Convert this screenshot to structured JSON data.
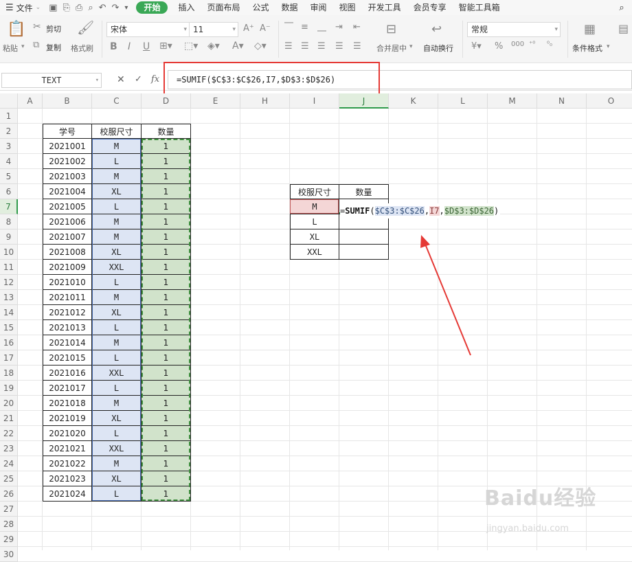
{
  "menu": {
    "file_label": "文件",
    "tabs": [
      {
        "label": "开始",
        "active": true
      },
      {
        "label": "插入"
      },
      {
        "label": "页面布局"
      },
      {
        "label": "公式"
      },
      {
        "label": "数据"
      },
      {
        "label": "审阅"
      },
      {
        "label": "视图"
      },
      {
        "label": "开发工具"
      },
      {
        "label": "会员专享"
      },
      {
        "label": "智能工具箱"
      }
    ]
  },
  "ribbon": {
    "paste": "粘贴",
    "cut": "剪切",
    "copy": "复制",
    "format_painter": "格式刷",
    "font_name": "宋体",
    "font_size": "11",
    "merge_center": "合并居中",
    "wrap_text": "自动换行",
    "number_format": "常规",
    "conditional_format": "条件格式"
  },
  "formula_bar": {
    "name_box": "TEXT",
    "fx": "fx",
    "formula": "=SUMIF($C$3:$C$26,I7,$D$3:$D$26)"
  },
  "columns": [
    "A",
    "B",
    "C",
    "D",
    "E",
    "H",
    "I",
    "J",
    "K",
    "L",
    "M",
    "N",
    "O"
  ],
  "rows": [
    "1",
    "2",
    "3",
    "4",
    "5",
    "6",
    "7",
    "8",
    "9",
    "10",
    "11",
    "12",
    "13",
    "14",
    "15",
    "16",
    "17",
    "18",
    "19",
    "20",
    "21",
    "22",
    "23",
    "24",
    "25",
    "26",
    "27",
    "28",
    "29",
    "30"
  ],
  "table1": {
    "headers": [
      "学号",
      "校服尺寸",
      "数量"
    ],
    "rows": [
      [
        "2021001",
        "M",
        "1"
      ],
      [
        "2021002",
        "L",
        "1"
      ],
      [
        "2021003",
        "M",
        "1"
      ],
      [
        "2021004",
        "XL",
        "1"
      ],
      [
        "2021005",
        "L",
        "1"
      ],
      [
        "2021006",
        "M",
        "1"
      ],
      [
        "2021007",
        "M",
        "1"
      ],
      [
        "2021008",
        "XL",
        "1"
      ],
      [
        "2021009",
        "XXL",
        "1"
      ],
      [
        "2021010",
        "L",
        "1"
      ],
      [
        "2021011",
        "M",
        "1"
      ],
      [
        "2021012",
        "XL",
        "1"
      ],
      [
        "2021013",
        "L",
        "1"
      ],
      [
        "2021014",
        "M",
        "1"
      ],
      [
        "2021015",
        "L",
        "1"
      ],
      [
        "2021016",
        "XXL",
        "1"
      ],
      [
        "2021017",
        "L",
        "1"
      ],
      [
        "2021018",
        "M",
        "1"
      ],
      [
        "2021019",
        "XL",
        "1"
      ],
      [
        "2021020",
        "L",
        "1"
      ],
      [
        "2021021",
        "XXL",
        "1"
      ],
      [
        "2021022",
        "M",
        "1"
      ],
      [
        "2021023",
        "XL",
        "1"
      ],
      [
        "2021024",
        "L",
        "1"
      ]
    ]
  },
  "table2": {
    "headers": [
      "校服尺寸",
      "数量"
    ],
    "sizes": [
      "M",
      "L",
      "XL",
      "XXL"
    ]
  },
  "cell_edit": {
    "prefix": "=",
    "fn": "SUMIF",
    "open": "(",
    "ref1": "$C$3:$C$26",
    "comma": ",",
    "ref2": "I7",
    "ref3": "$D$3:$D$26",
    "close": ")"
  },
  "watermark": {
    "main": "Baidu经验",
    "sub": "jingyan.baidu.com"
  },
  "colors": {
    "accent_green": "#3aa856",
    "highlight_red": "#e53935",
    "range_blue": "#dde5f4",
    "range_green": "#d1e3cb"
  }
}
